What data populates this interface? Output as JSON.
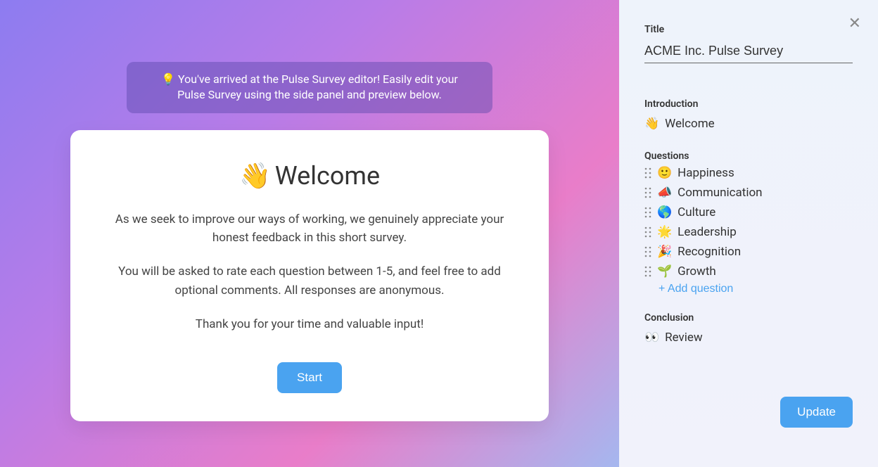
{
  "banner": {
    "icon": "💡",
    "text": "You've arrived at the Pulse Survey editor! Easily edit your Pulse Survey using the side panel and preview below."
  },
  "preview": {
    "heading_emoji": "👋",
    "heading_text": "Welcome",
    "para1": "As we seek to improve our ways of working, we genuinely appreciate your honest feedback in this short survey.",
    "para2": "You will be asked to rate each question between 1-5, and feel free to add optional comments. All responses are anonymous.",
    "para3": "Thank you for your time and valuable input!",
    "start_label": "Start"
  },
  "sidebar": {
    "title_label": "Title",
    "title_value": "ACME Inc. Pulse Survey",
    "introduction_label": "Introduction",
    "introduction_item": {
      "emoji": "👋",
      "label": "Welcome"
    },
    "questions_label": "Questions",
    "questions": [
      {
        "emoji": "🙂",
        "label": "Happiness"
      },
      {
        "emoji": "📣",
        "label": "Communication"
      },
      {
        "emoji": "🌎",
        "label": "Culture"
      },
      {
        "emoji": "🌟",
        "label": "Leadership"
      },
      {
        "emoji": "🎉",
        "label": "Recognition"
      },
      {
        "emoji": "🌱",
        "label": "Growth"
      }
    ],
    "add_question_label": "+ Add question",
    "conclusion_label": "Conclusion",
    "conclusion_item": {
      "emoji": "👀",
      "label": "Review"
    },
    "update_label": "Update"
  }
}
